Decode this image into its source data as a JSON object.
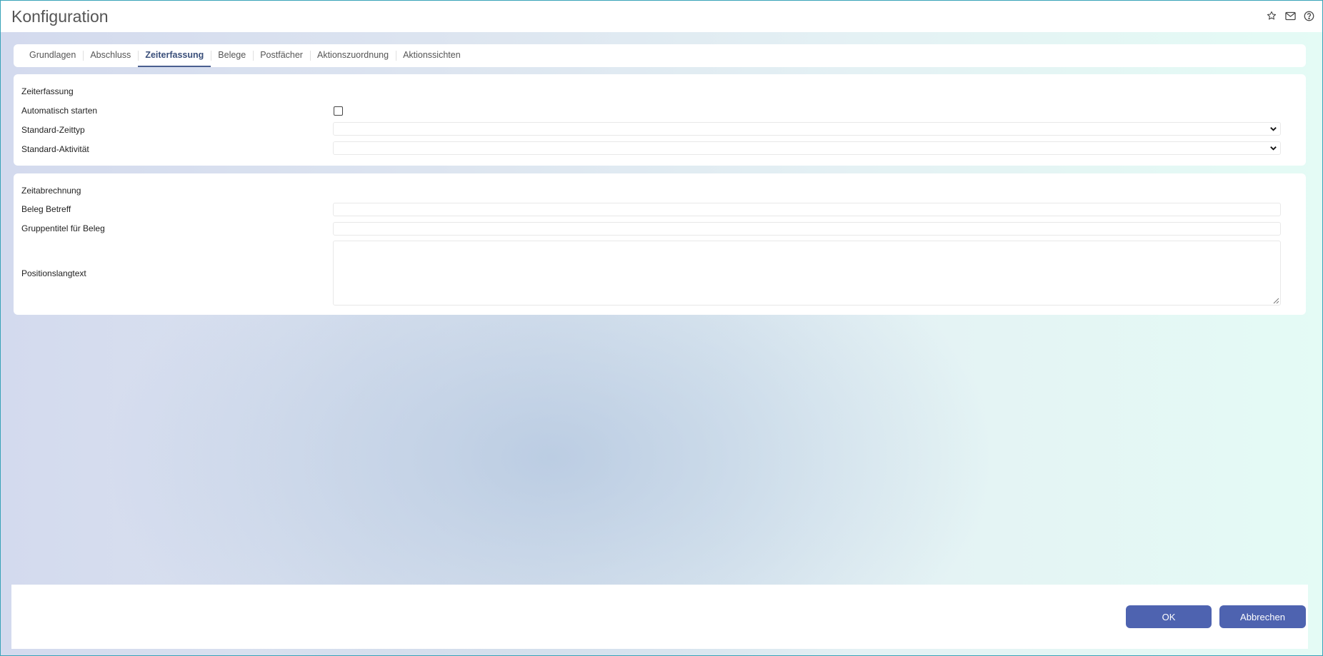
{
  "window": {
    "title": "Konfiguration",
    "icons": [
      "star-icon",
      "mail-icon",
      "help-icon"
    ]
  },
  "tabs": [
    {
      "label": "Grundlagen",
      "active": false
    },
    {
      "label": "Abschluss",
      "active": false
    },
    {
      "label": "Zeiterfassung",
      "active": true
    },
    {
      "label": "Belege",
      "active": false
    },
    {
      "label": "Postfächer",
      "active": false
    },
    {
      "label": "Aktionszuordnung",
      "active": false
    },
    {
      "label": "Aktionssichten",
      "active": false
    }
  ],
  "zeiterfassung": {
    "title": "Zeiterfassung",
    "auto_start_label": "Automatisch starten",
    "auto_start_checked": false,
    "zeittyp_label": "Standard-Zeittyp",
    "zeittyp_value": "",
    "aktivitaet_label": "Standard-Aktivität",
    "aktivitaet_value": ""
  },
  "zeitabrechnung": {
    "title": "Zeitabrechnung",
    "beleg_betreff_label": "Beleg Betreff",
    "beleg_betreff_value": "",
    "gruppentitel_label": "Gruppentitel für Beleg",
    "gruppentitel_value": "",
    "positionslangtext_label": "Positionslangtext",
    "positionslangtext_value": ""
  },
  "footer": {
    "ok_label": "OK",
    "cancel_label": "Abbrechen"
  },
  "colors": {
    "accent": "#4e63b0",
    "active_tab": "#3a4f7a",
    "frame": "#3aa3b8"
  }
}
